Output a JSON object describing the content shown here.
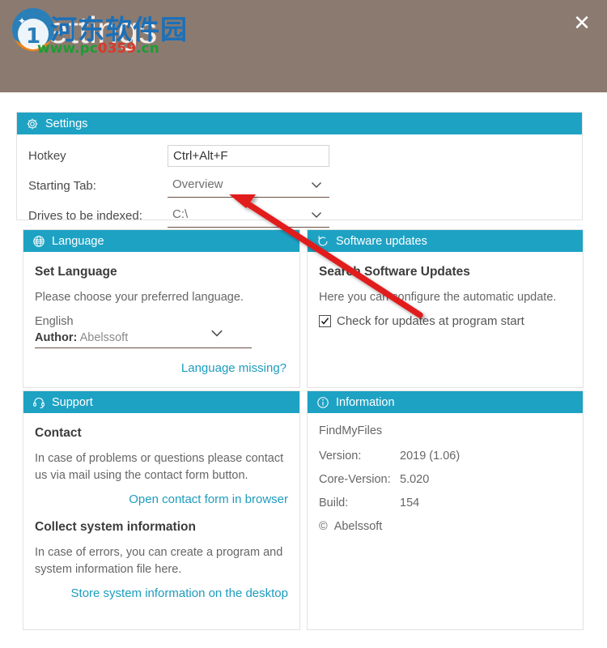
{
  "window": {
    "title": "Settings",
    "close_label": "✕",
    "header_bg": "#8b7a70",
    "accent": "#1ea2c4",
    "link_color": "#1d9cbe"
  },
  "watermark": {
    "chinese": "河东软件园",
    "url_prefix": "www.pc",
    "url_number": "0359",
    "url_suffix": ".cn"
  },
  "settings_panel": {
    "title": "Settings",
    "icon": "gear-icon",
    "rows": [
      {
        "label": "Hotkey",
        "value": "Ctrl+Alt+F",
        "type": "textbox"
      },
      {
        "label": "Starting Tab:",
        "value": "Overview",
        "type": "dropdown"
      },
      {
        "label": "Drives to be indexed:",
        "value": "C:\\",
        "type": "dropdown"
      }
    ]
  },
  "language_panel": {
    "title": "Language",
    "icon": "globe-icon",
    "heading": "Set Language",
    "description": "Please choose your preferred language.",
    "selected_language": "English",
    "author_label": "Author:",
    "author_value": "Abelssoft",
    "missing_link": "Language missing?"
  },
  "updates_panel": {
    "title": "Software updates",
    "icon": "refresh-icon",
    "heading": "Search Software Updates",
    "description": "Here you can configure the automatic update.",
    "checkbox_label": "Check for updates at program start",
    "checkbox_checked": true
  },
  "support_panel": {
    "title": "Support",
    "icon": "headset-icon",
    "contact_heading": "Contact",
    "contact_text": "In case of problems or questions please contact us via mail using the contact form button.",
    "contact_link": "Open contact form in browser",
    "collect_heading": "Collect system information",
    "collect_text": "In case of errors, you can create a program and system information file here.",
    "collect_link": "Store system information on the desktop"
  },
  "information_panel": {
    "title": "Information",
    "icon": "info-icon",
    "app_name": "FindMyFiles",
    "rows": [
      {
        "key": "Version:",
        "value": "2019 (1.06)"
      },
      {
        "key": "Core-Version:",
        "value": "5.020"
      },
      {
        "key": "Build:",
        "value": "154"
      }
    ],
    "copyright_symbol": "©",
    "copyright_owner": "Abelssoft"
  }
}
